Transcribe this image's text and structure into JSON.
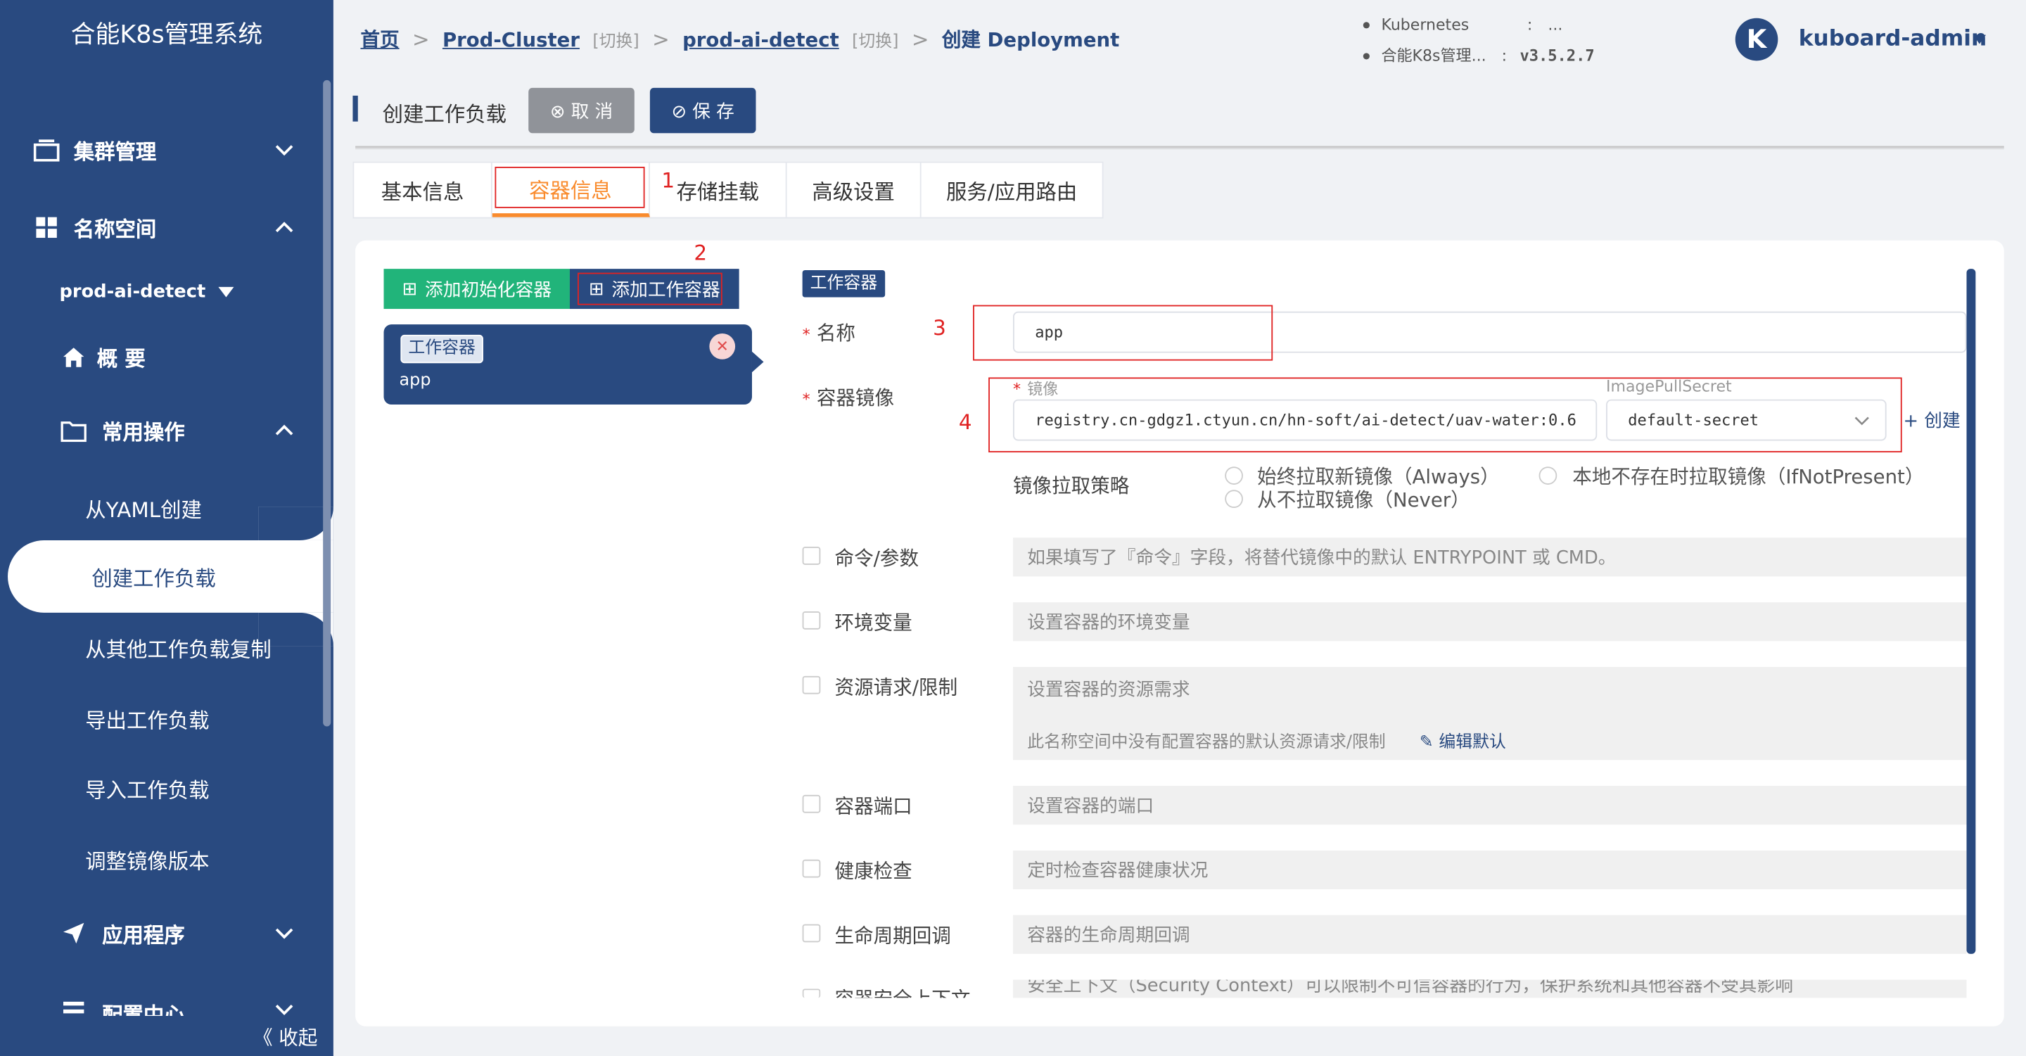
{
  "app_title": "合能K8s管理系统",
  "sidebar": {
    "cut_item": "",
    "items": [
      {
        "label": "集群管理"
      },
      {
        "label": "名称空间"
      },
      {
        "label": "概 要"
      },
      {
        "label": "常用操作"
      },
      {
        "label": "应用程序"
      },
      {
        "label": "配置中心"
      }
    ],
    "namespace": "prod-ai-detect",
    "sub_items": [
      "从YAML创建",
      "创建工作负载",
      "从其他工作负载复制",
      "导出工作负载",
      "导入工作负载",
      "调整镜像版本"
    ],
    "collapse_label": "《 收起"
  },
  "breadcrumb": {
    "home": "首页",
    "cluster": "Prod-Cluster",
    "switch1": "[切换]",
    "namespace": "prod-ai-detect",
    "switch2": "[切换]",
    "current": "创建 Deployment"
  },
  "version_info": {
    "line1_label": "Kubernetes",
    "line1_sep": ":",
    "line1_value": "...",
    "line2_label": "合能K8s管理...",
    "line2_sep": ":",
    "line2_value": "v3.5.2.7"
  },
  "user": {
    "avatar_letter": "K",
    "name": "kuboard-admin"
  },
  "toolbar": {
    "title": "创建工作负载",
    "cancel_label": "⊗ 取 消",
    "save_label": "⊘ 保 存"
  },
  "tabs": [
    "基本信息",
    "容器信息",
    "存储挂载",
    "高级设置",
    "服务/应用路由"
  ],
  "annotations": [
    "1",
    "2",
    "3",
    "4"
  ],
  "container_panel": {
    "add_init_label": "添加初始化容器",
    "add_work_label": "添加工作容器",
    "card_tag": "工作容器",
    "card_name": "app",
    "close_glyph": "✕"
  },
  "form": {
    "section_tag": "工作容器",
    "name_label": "名称",
    "name_value": "app",
    "image_label": "容器镜像",
    "image_sub_label": "镜像",
    "image_value": "registry.cn-gdgz1.ctyun.cn/hn-soft/ai-detect/uav-water:0.6",
    "secret_label": "ImagePullSecret",
    "secret_value": "default-secret",
    "create_link": "+ 创建",
    "pull_policy_label": "镜像拉取策略",
    "pull_options": [
      "始终拉取新镜像（Always）",
      "从不拉取镜像（Never）",
      "本地不存在时拉取镜像（IfNotPresent）"
    ],
    "rows": [
      {
        "label": "命令/参数",
        "placeholder": "如果填写了『命令』字段，将替代镜像中的默认 ENTRYPOINT 或 CMD。"
      },
      {
        "label": "环境变量",
        "placeholder": "设置容器的环境变量"
      },
      {
        "label": "资源请求/限制",
        "placeholder": "设置容器的资源需求"
      },
      {
        "label": "容器端口",
        "placeholder": "设置容器的端口"
      },
      {
        "label": "健康检查",
        "placeholder": "定时检查容器健康状况"
      },
      {
        "label": "生命周期回调",
        "placeholder": "容器的生命周期回调"
      },
      {
        "label": "容器安全上下文",
        "placeholder": "安全上下文（Security Context）可以限制不可信容器的行为，保护系统和其他容器不受其影响"
      }
    ],
    "resource_note": "此名称空间中没有配置容器的默认资源请求/限制",
    "edit_default": "编辑默认"
  }
}
